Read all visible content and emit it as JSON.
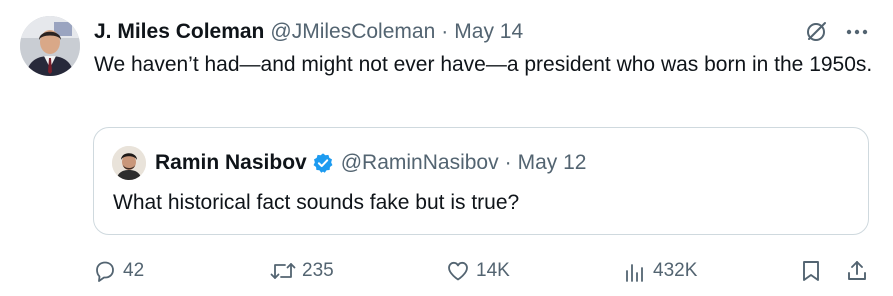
{
  "tweet": {
    "display_name": "J. Miles Coleman",
    "handle": "@JMilesColeman",
    "separator": "·",
    "date": "May 14",
    "text": "We haven’t had—and might not ever have—a president who was born in the 1950s."
  },
  "quote": {
    "display_name": "Ramin Nasibov",
    "handle": "@RaminNasibov",
    "separator": "·",
    "date": "May 12",
    "text": "What historical fact sounds fake but is true?",
    "verified": true
  },
  "actions": {
    "replies": "42",
    "reposts": "235",
    "likes": "14K",
    "views": "432K"
  },
  "icons": {
    "grok": "grok-icon",
    "more": "more-icon",
    "reply": "reply-icon",
    "repost": "repost-icon",
    "like": "heart-icon",
    "views": "analytics-icon",
    "bookmark": "bookmark-icon",
    "share": "share-icon"
  },
  "colors": {
    "text": "#0f1419",
    "secondary": "#536471",
    "border": "#cfd9de",
    "verified": "#1d9bf0"
  }
}
